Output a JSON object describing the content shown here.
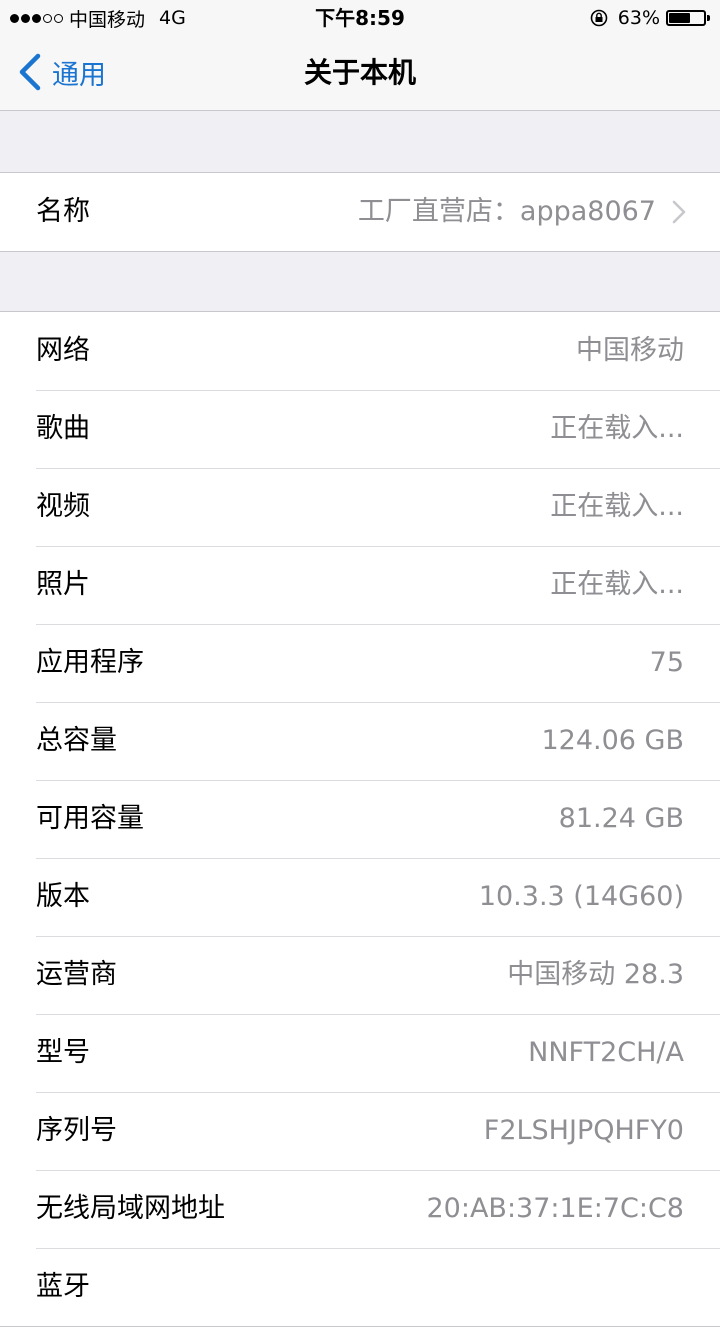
{
  "status_bar": {
    "carrier": "中国移动",
    "network": "4G",
    "time": "下午8:59",
    "battery_percent": "63%",
    "battery_level": 0.63,
    "signal_dots": [
      true,
      true,
      true,
      false,
      false
    ]
  },
  "nav": {
    "back_label": "通用",
    "title": "关于本机"
  },
  "group1": {
    "rows": [
      {
        "label": "名称",
        "value": "工厂直营店：appa8067"
      }
    ]
  },
  "group2": {
    "rows": [
      {
        "label": "网络",
        "value": "中国移动"
      },
      {
        "label": "歌曲",
        "value": "正在载入..."
      },
      {
        "label": "视频",
        "value": "正在载入..."
      },
      {
        "label": "照片",
        "value": "正在载入..."
      },
      {
        "label": "应用程序",
        "value": "75"
      },
      {
        "label": "总容量",
        "value": "124.06 GB"
      },
      {
        "label": "可用容量",
        "value": "81.24 GB"
      },
      {
        "label": "版本",
        "value": "10.3.3 (14G60)"
      },
      {
        "label": "运营商",
        "value": "中国移动 28.3"
      },
      {
        "label": "型号",
        "value": "NNFT2CH/A"
      },
      {
        "label": "序列号",
        "value": "F2LSHJPQHFY0"
      },
      {
        "label": "无线局域网地址",
        "value": "20:AB:37:1E:7C:C8"
      },
      {
        "label": "蓝牙",
        "value": ""
      }
    ]
  },
  "colors": {
    "accent": "#1b75d0",
    "background": "#efeff4",
    "secondary_text": "#8e8e93"
  },
  "icons": [
    "signal-dots",
    "lock-rotation-icon",
    "battery-icon",
    "back-chevron-icon",
    "row-chevron-icon"
  ]
}
